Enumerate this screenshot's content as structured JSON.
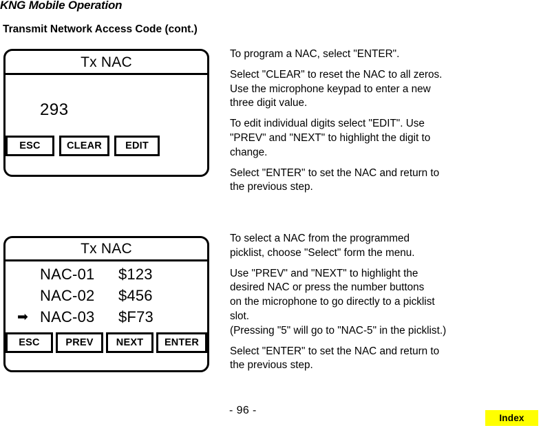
{
  "header": {
    "running_head": "KNG Mobile Operation",
    "section_title": "Transmit Network Access Code (cont.)"
  },
  "screens": [
    {
      "id": "tx-nac-edit",
      "title": "Tx NAC",
      "value": "293",
      "softkeys": [
        "ESC",
        "CLEAR",
        "EDIT"
      ]
    },
    {
      "id": "tx-nac-picklist",
      "title": "Tx NAC",
      "items": [
        {
          "marker": "",
          "label": "NAC-01",
          "value": "$123"
        },
        {
          "marker": "",
          "label": "NAC-02",
          "value": "$456"
        },
        {
          "marker": "➡",
          "label": "NAC-03",
          "value": "$F73"
        }
      ],
      "softkeys": [
        "ESC",
        "PREV",
        "NEXT",
        "ENTER"
      ]
    }
  ],
  "instructions": {
    "block1": [
      "To program a NAC, select \"ENTER\".",
      "Select \"CLEAR\" to reset the NAC to all zeros.\nUse the microphone keypad to enter a new\nthree digit value.",
      "To edit individual digits select \"EDIT\". Use\n\"PREV\" and \"NEXT\" to highlight the digit to\nchange.",
      "Select \"ENTER\" to set the NAC and return to\nthe previous step."
    ],
    "block2": [
      "To select a NAC from the programmed\npicklist, choose \"Select\" form the menu.",
      "Use \"PREV\" and \"NEXT\" to highlight the\ndesired NAC or press the number buttons\non the microphone to go directly to a picklist\nslot.\n(Pressing \"5\" will go to \"NAC-5\" in the picklist.)",
      "Select \"ENTER\" to set the NAC and return to\nthe previous step."
    ]
  },
  "footer": {
    "page_number": "- 96 -",
    "index_label": "Index",
    "index_color": "#ffff00"
  }
}
